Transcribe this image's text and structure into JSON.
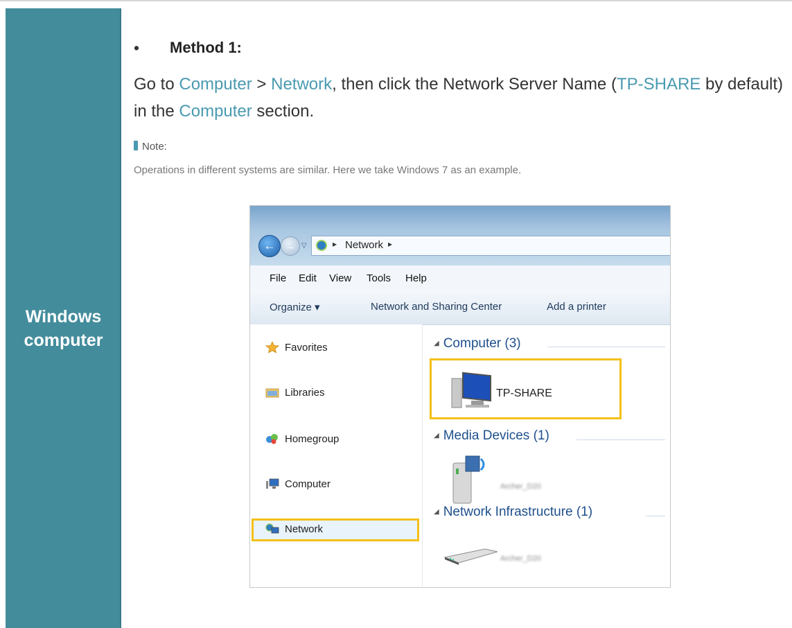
{
  "sidebar": {
    "label": "Windows\ncomputer"
  },
  "method": {
    "bullet": "•",
    "title": "Method 1:"
  },
  "instruction": {
    "t1": "Go to ",
    "l1": "Computer",
    "t2": " > ",
    "l2": "Network",
    "t3": ", then click the Network Server Name (",
    "l3": "TP-SHARE",
    "t4": " by default) in the ",
    "l4": "Computer",
    "t5": " section."
  },
  "note": {
    "heading": "Note:",
    "text": "Operations in different systems are similar. Here we take Windows 7 as an example."
  },
  "explorer": {
    "address": {
      "crumb": "Network",
      "back_glyph": "←",
      "forward_glyph": "→"
    },
    "menu": [
      "File",
      "Edit",
      "View",
      "Tools",
      "Help"
    ],
    "commands": {
      "organize": "Organize ▾",
      "network_center": "Network and Sharing Center",
      "add_printer": "Add a printer"
    },
    "nav": {
      "favorites": "Favorites",
      "libraries": "Libraries",
      "homegroup": "Homegroup",
      "computer": "Computer",
      "network": "Network"
    },
    "groups": {
      "computer": "Computer (3)",
      "media": "Media Devices (1)",
      "infra": "Network Infrastructure (1)"
    },
    "items": {
      "tp_share": "TP-SHARE",
      "media_device": "Archer_D20",
      "infra_device": "Archer_D20"
    }
  },
  "colors": {
    "sidebar": "#438c9c",
    "link": "#4a9ab0",
    "highlight": "#f3c018"
  }
}
